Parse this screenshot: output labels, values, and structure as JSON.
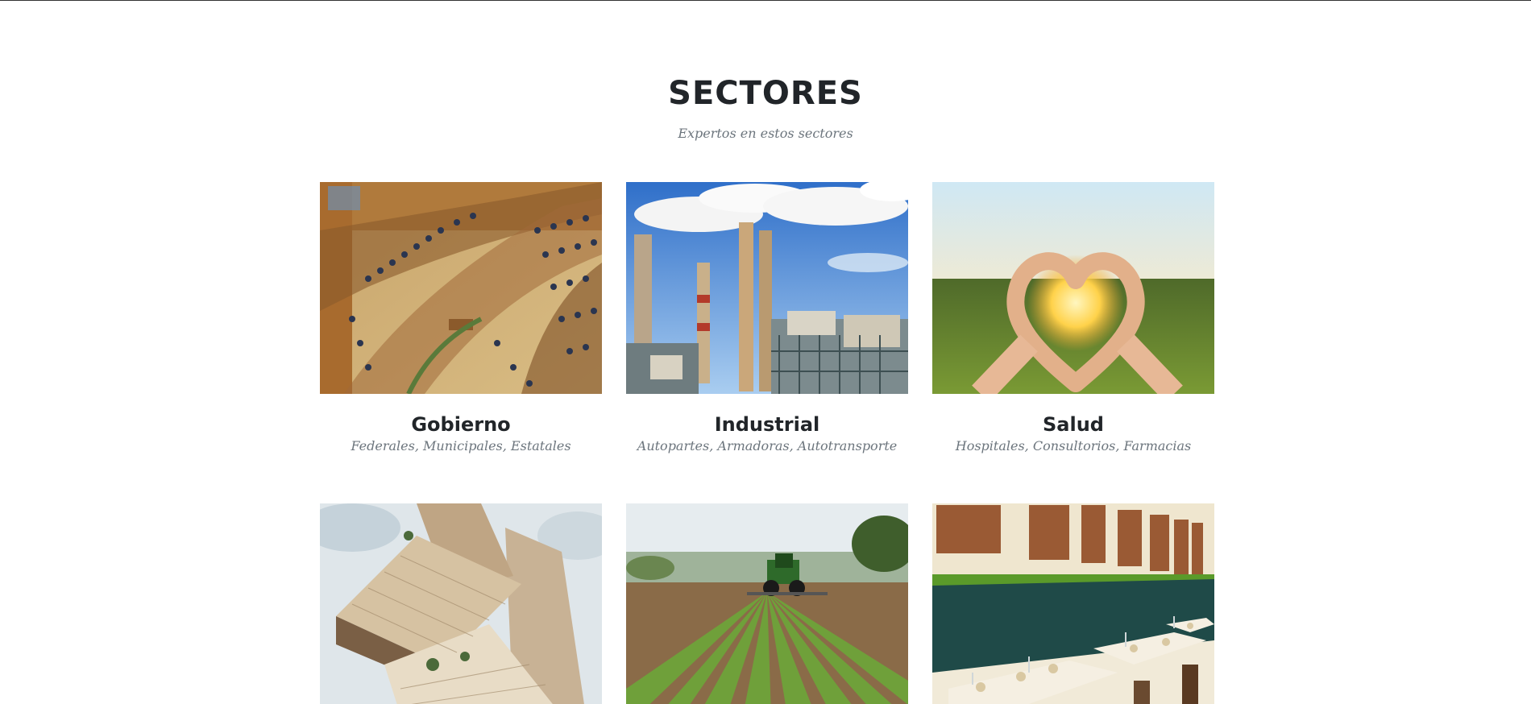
{
  "section": {
    "title": "SECTORES",
    "subtitle": "Expertos en estos sectores"
  },
  "cards": [
    {
      "image": "parliament-chamber-image",
      "title": "Gobierno",
      "desc": "Federales, Municipales, Estatales"
    },
    {
      "image": "factory-smokestacks-image",
      "title": "Industrial",
      "desc": "Autopartes, Armadoras, Autotransporte"
    },
    {
      "image": "heart-hands-sunset-image",
      "title": "Salud",
      "desc": "Hospitales, Consultorios, Farmacias"
    },
    {
      "image": "modern-tower-building-image",
      "title": "",
      "desc": ""
    },
    {
      "image": "tractor-crop-field-image",
      "title": "",
      "desc": ""
    },
    {
      "image": "restaurant-dining-room-image",
      "title": "",
      "desc": ""
    }
  ]
}
